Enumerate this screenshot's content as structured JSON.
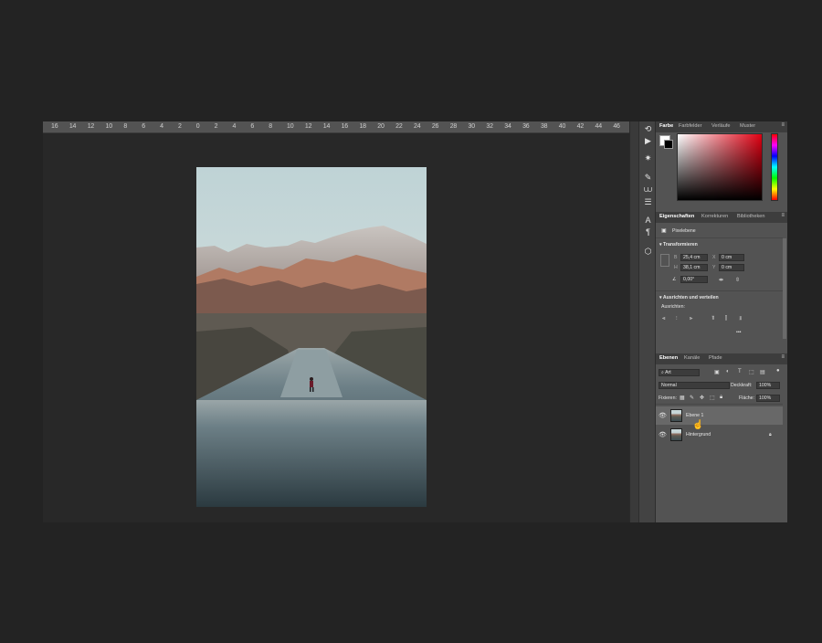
{
  "ruler": {
    "ticks": [
      "16",
      "14",
      "12",
      "10",
      "8",
      "6",
      "4",
      "2",
      "0",
      "2",
      "4",
      "6",
      "8",
      "10",
      "12",
      "14",
      "16",
      "18",
      "20",
      "22",
      "24",
      "26",
      "28",
      "30",
      "32",
      "34",
      "36",
      "38",
      "40",
      "42",
      "44",
      "46"
    ]
  },
  "color_panel": {
    "tabs": [
      "Farbe",
      "Farbfelder",
      "Verläufe",
      "Muster"
    ]
  },
  "properties_panel": {
    "tabs": [
      "Eigenschaften",
      "Korrekturen",
      "Bibliotheken"
    ],
    "layer_type": "Pixelebene",
    "transform_title": "Transformieren",
    "w_label": "B",
    "w_value": "25,4 cm",
    "x_label": "X",
    "x_value": "0 cm",
    "h_label": "H",
    "h_value": "38,1 cm",
    "y_label": "Y",
    "y_value": "0 cm",
    "angle_value": "0,00°",
    "align_title": "Ausrichten und verteilen",
    "align_label": "Ausrichten:",
    "more": "•••"
  },
  "layers_panel": {
    "tabs": [
      "Ebenen",
      "Kanäle",
      "Pfade"
    ],
    "filter_kind": "Art",
    "blend_mode": "Normal",
    "opacity_label": "Deckkraft:",
    "opacity_value": "100%",
    "lock_label": "Fixieren:",
    "fill_label": "Fläche:",
    "fill_value": "100%",
    "layers": [
      {
        "name": "Ebene 1",
        "selected": true
      },
      {
        "name": "Hintergrund",
        "selected": false
      }
    ]
  },
  "colors": {
    "accent_foreground": "#ffffff",
    "accent_background": "#000000",
    "selected_layer": "#686868"
  }
}
